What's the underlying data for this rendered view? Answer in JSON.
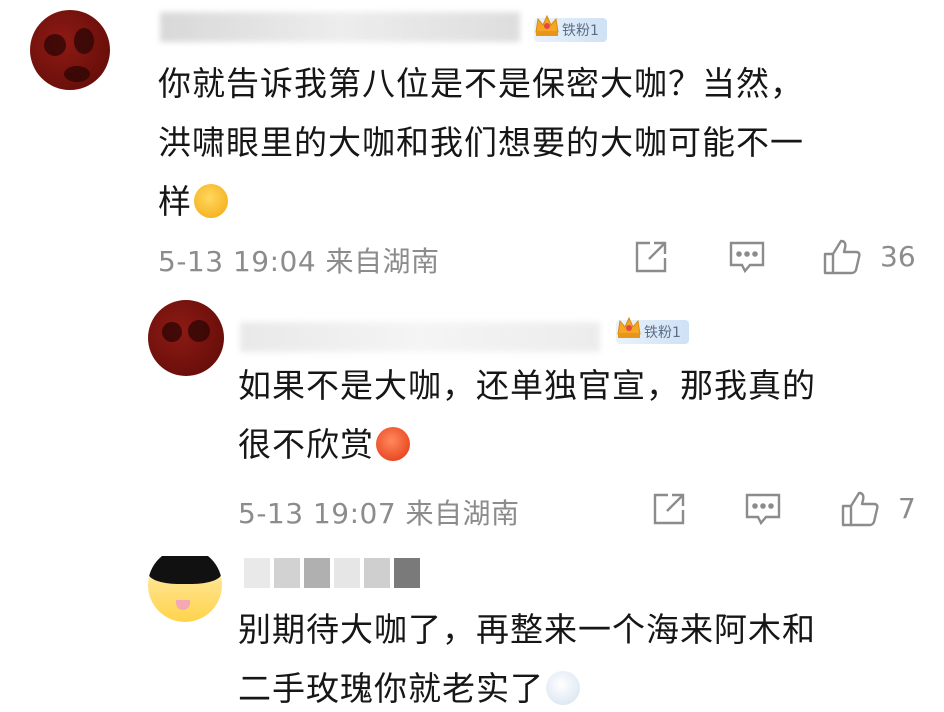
{
  "comments": [
    {
      "badge": "铁粉1",
      "text_lines": [
        "你就告诉我第八位是不是保密大咖？当然，",
        "洪啸眼里的大咖和我们想要的大咖可能不一",
        "样"
      ],
      "time": "5-13 19:04",
      "location": "来自湖南",
      "likes": "36",
      "emoji": "sleepy-face-icon"
    },
    {
      "badge": "铁粉1",
      "text_lines": [
        "如果不是大咖，还单独官宣，那我真的",
        "很不欣赏"
      ],
      "time": "5-13 19:07",
      "location": "来自湖南",
      "likes": "7",
      "emoji": "angry-face-icon"
    },
    {
      "text_lines": [
        "别期待大咖了，再整来一个海来阿木和",
        "二手玫瑰你就老实了"
      ],
      "emoji": "scared-face-icon"
    }
  ],
  "colors": {
    "text": "#161616",
    "meta": "#8c8c8c",
    "badge_bg": "#cfe1f5",
    "badge_text": "#5a6e86"
  }
}
